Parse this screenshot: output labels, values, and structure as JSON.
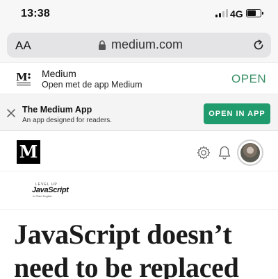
{
  "status_bar": {
    "time": "13:38",
    "network": "4G"
  },
  "browser": {
    "text_size_label": "AA",
    "url": "medium.com"
  },
  "app_banner": {
    "name": "Medium",
    "description": "Open met de app Medium",
    "open_label": "OPEN",
    "accent_color": "#3a8f66"
  },
  "promo": {
    "title": "The Medium App",
    "subtitle": "An app designed for readers.",
    "button_label": "OPEN IN APP",
    "button_color": "#1f9b6e"
  },
  "header": {
    "logo_letter": "M"
  },
  "publication": {
    "tagline": "LEVEL UP",
    "name": "JavaScript",
    "sub": "In Plain English"
  },
  "article": {
    "title": "JavaScript doesn’t need to be replaced"
  }
}
